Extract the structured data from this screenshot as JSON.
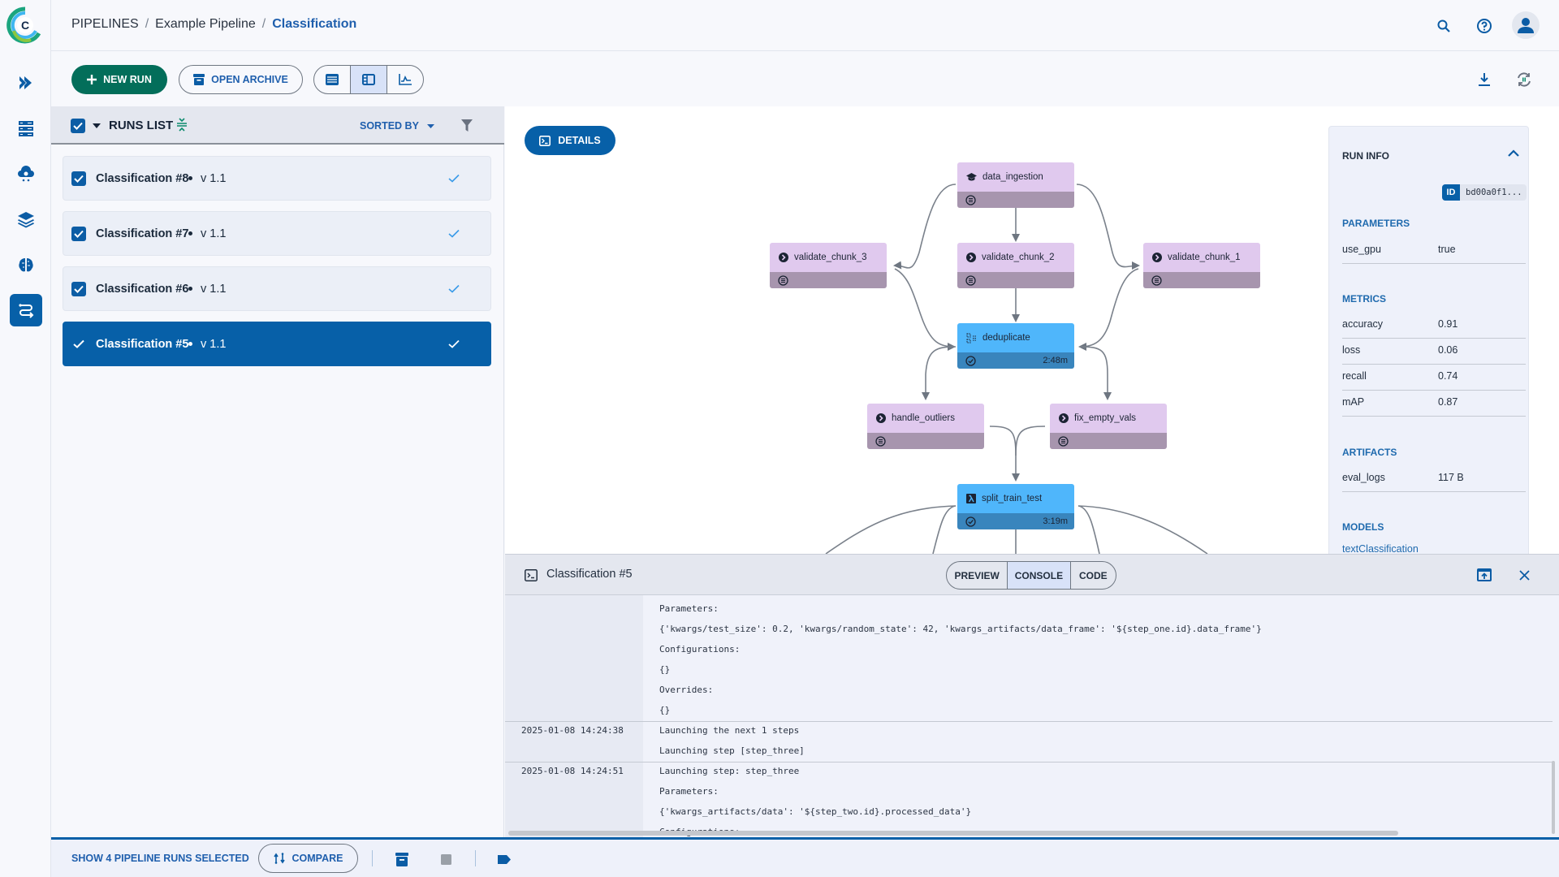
{
  "app": {
    "logo_letter": "C"
  },
  "breadcrumb": {
    "root": "PIPELINES",
    "parent": "Example Pipeline",
    "current": "Classification",
    "separator": "/"
  },
  "nav": [
    {
      "name": "projects",
      "icon": "double-chevron-right-icon"
    },
    {
      "name": "datasets",
      "icon": "database-icon"
    },
    {
      "name": "orchestration",
      "icon": "cloud-gear-icon"
    },
    {
      "name": "layers",
      "icon": "layers-icon"
    },
    {
      "name": "models",
      "icon": "brain-icon"
    },
    {
      "name": "pipelines",
      "icon": "pipelines-icon",
      "active": true
    }
  ],
  "toolbar": {
    "new_run": "NEW RUN",
    "open_archive": "OPEN ARCHIVE",
    "view_modes": [
      "list-view",
      "details-view",
      "chart-view"
    ],
    "active_view": "details-view"
  },
  "runs_list": {
    "title": "RUNS LIST",
    "sorted_by": "SORTED BY",
    "items": [
      {
        "name": "Classification #8",
        "version": "v 1.1",
        "status": "completed",
        "checked": true,
        "selected": false
      },
      {
        "name": "Classification #7",
        "version": "v 1.1",
        "status": "completed",
        "checked": true,
        "selected": false
      },
      {
        "name": "Classification #6",
        "version": "v 1.1",
        "status": "completed",
        "checked": true,
        "selected": false
      },
      {
        "name": "Classification #5",
        "version": "v 1.1",
        "status": "completed",
        "checked": true,
        "selected": true
      }
    ]
  },
  "graph": {
    "details_button": "DETAILS",
    "nodes": [
      {
        "id": "data_ingestion",
        "label": "data_ingestion",
        "icon": "graduation-cap-icon",
        "status": "pending",
        "duration": ""
      },
      {
        "id": "validate_chunk_3",
        "label": "validate_chunk_3",
        "icon": "step-icon",
        "status": "pending",
        "duration": ""
      },
      {
        "id": "validate_chunk_2",
        "label": "validate_chunk_2",
        "icon": "step-icon",
        "status": "pending",
        "duration": ""
      },
      {
        "id": "validate_chunk_1",
        "label": "validate_chunk_1",
        "icon": "step-icon",
        "status": "pending",
        "duration": ""
      },
      {
        "id": "deduplicate",
        "label": "deduplicate",
        "icon": "dedupe-icon",
        "status": "completed",
        "duration": "2:48m"
      },
      {
        "id": "handle_outliers",
        "label": "handle_outliers",
        "icon": "step-icon",
        "status": "pending",
        "duration": ""
      },
      {
        "id": "fix_empty_vals",
        "label": "fix_empty_vals",
        "icon": "step-icon",
        "status": "pending",
        "duration": ""
      },
      {
        "id": "split_train_test",
        "label": "split_train_test",
        "icon": "lambda-icon",
        "status": "completed",
        "duration": "3:19m"
      }
    ]
  },
  "run_info": {
    "title": "RUN INFO",
    "id_key": "ID",
    "id_value": "bd00a0f1...",
    "parameters_title": "PARAMETERS",
    "parameters": [
      {
        "key": "use_gpu",
        "value": "true"
      }
    ],
    "metrics_title": "METRICS",
    "metrics": [
      {
        "key": "accuracy",
        "value": "0.91"
      },
      {
        "key": "loss",
        "value": "0.06"
      },
      {
        "key": "recall",
        "value": "0.74"
      },
      {
        "key": "mAP",
        "value": "0.87"
      }
    ],
    "artifacts_title": "ARTIFACTS",
    "artifacts": [
      {
        "key": "eval_logs",
        "value": "117 B"
      }
    ],
    "models_title": "MODELS",
    "models": [
      "textClassification"
    ]
  },
  "console": {
    "title": "Classification #5",
    "tabs": [
      "PREVIEW",
      "CONSOLE",
      "CODE"
    ],
    "active_tab": "CONSOLE",
    "entries": [
      {
        "timestamp": "",
        "lines": [
          "Parameters:",
          "{'kwargs/test_size': 0.2, 'kwargs/random_state': 42, 'kwargs_artifacts/data_frame': '${step_one.id}.data_frame'}",
          "Configurations:",
          "{}",
          "Overrides:",
          "{}"
        ]
      },
      {
        "timestamp": "2025-01-08 14:24:38",
        "lines": [
          "Launching the next 1 steps",
          "Launching step [step_three]"
        ]
      },
      {
        "timestamp": "2025-01-08 14:24:51",
        "lines": [
          "Launching step: step_three",
          "Parameters:",
          "{'kwargs_artifacts/data': '${step_two.id}.processed_data'}",
          "Configurations:"
        ]
      }
    ]
  },
  "bottom_bar": {
    "selection_label": "SHOW 4 PIPELINE RUNS SELECTED",
    "compare": "COMPARE"
  }
}
